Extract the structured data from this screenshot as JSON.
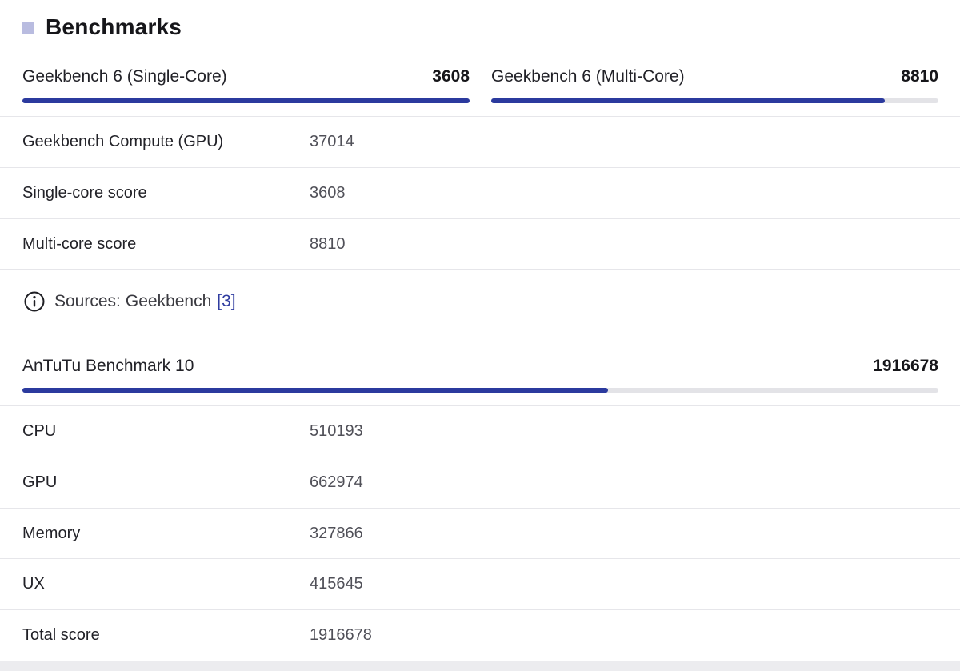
{
  "section": {
    "title": "Benchmarks",
    "accent_color": "#b9bce0"
  },
  "geekbench_single": {
    "label": "Geekbench 6 (Single-Core)",
    "value": "3608",
    "fill_fraction": 1.0
  },
  "geekbench_multi": {
    "label": "Geekbench 6 (Multi-Core)",
    "value": "8810",
    "fill_fraction": 0.88
  },
  "geekbench_details": [
    {
      "label": "Geekbench Compute (GPU)",
      "value": "37014"
    },
    {
      "label": "Single-core score",
      "value": "3608"
    },
    {
      "label": "Multi-core score",
      "value": "8810"
    }
  ],
  "sources": {
    "prefix": "Sources:",
    "name": "Geekbench",
    "ref": "[3]",
    "icon": "info-icon"
  },
  "antutu": {
    "label": "AnTuTu Benchmark 10",
    "value": "1916678",
    "fill_fraction": 0.639
  },
  "antutu_details": [
    {
      "label": "CPU",
      "value": "510193"
    },
    {
      "label": "GPU",
      "value": "662974"
    },
    {
      "label": "Memory",
      "value": "327866"
    },
    {
      "label": "UX",
      "value": "415645"
    },
    {
      "label": "Total score",
      "value": "1916678"
    }
  ],
  "colors": {
    "bar_fill": "#2b3a9e",
    "bar_track": "#e3e3e7",
    "link": "#2f3ca0"
  }
}
